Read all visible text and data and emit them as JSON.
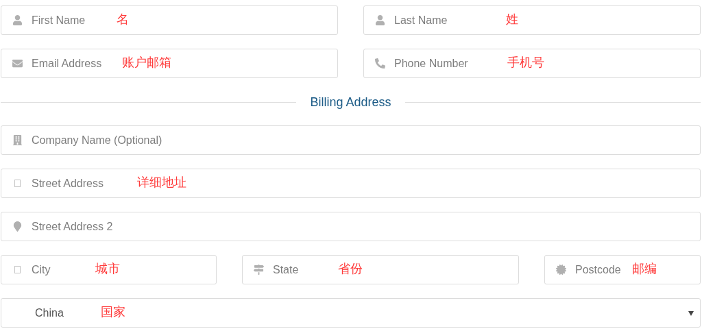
{
  "contact_rows": [
    {
      "fields": [
        {
          "placeholder": "First Name",
          "note": "名"
        },
        {
          "placeholder": "Last Name",
          "note": "姓"
        }
      ]
    },
    {
      "fields": [
        {
          "placeholder": "Email Address",
          "note": "账户邮箱"
        },
        {
          "placeholder": "Phone Number",
          "note": "手机号"
        }
      ]
    }
  ],
  "section_title": "Billing Address",
  "address_rows": [
    {
      "fields": [
        {
          "placeholder": "Company Name (Optional)"
        }
      ]
    },
    {
      "fields": [
        {
          "placeholder": "Street Address",
          "note": "详细地址"
        }
      ]
    },
    {
      "fields": [
        {
          "placeholder": "Street Address 2"
        }
      ]
    },
    {
      "fields": [
        {
          "placeholder": "City",
          "note": "城市"
        },
        {
          "placeholder": "State",
          "note": "省份"
        },
        {
          "placeholder": "Postcode",
          "note": "邮编"
        }
      ]
    }
  ],
  "country_select": {
    "value": "China",
    "note": "国家"
  }
}
